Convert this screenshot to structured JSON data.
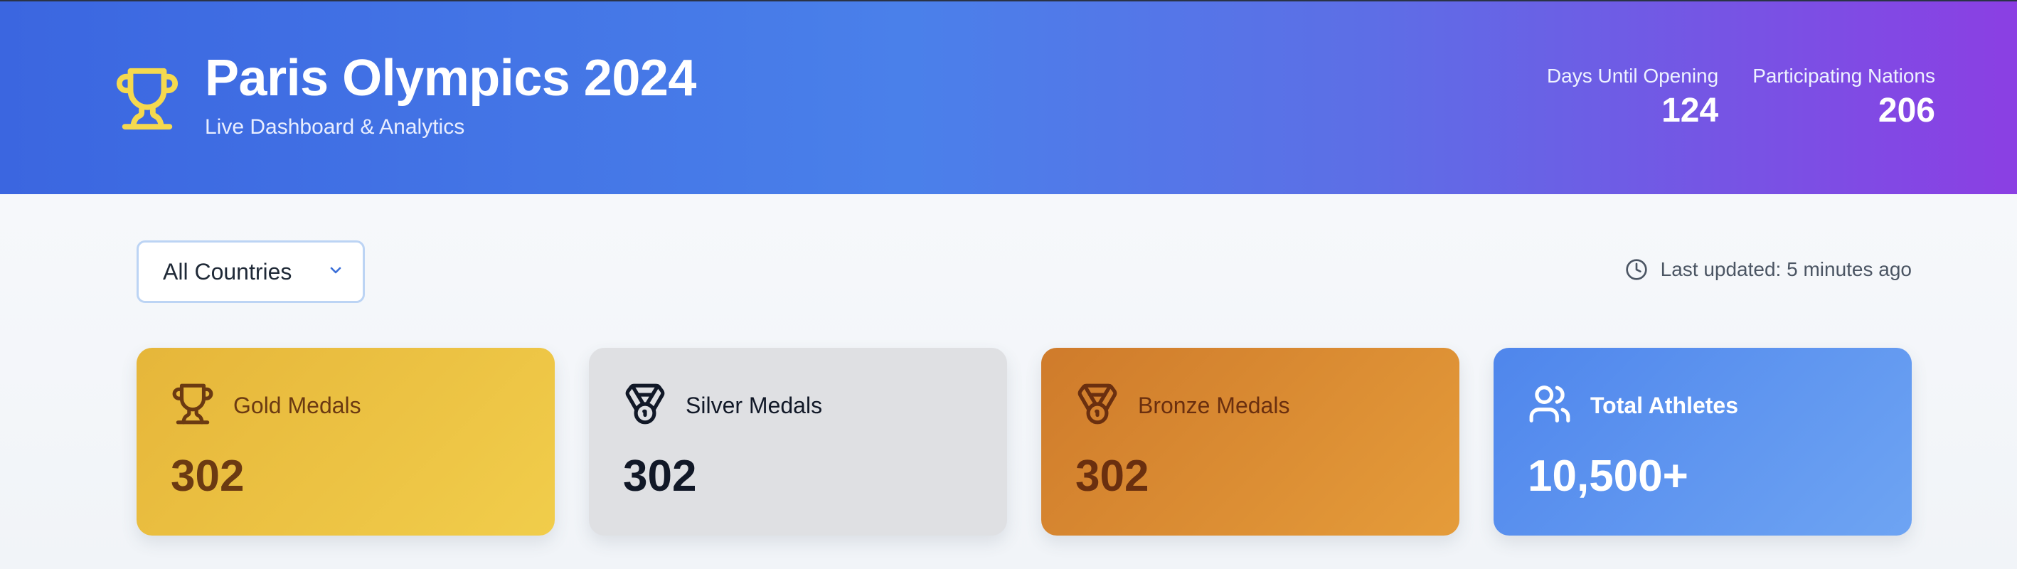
{
  "header": {
    "title": "Paris Olympics 2024",
    "subtitle": "Live Dashboard & Analytics",
    "stats": [
      {
        "label": "Days Until Opening",
        "value": "124"
      },
      {
        "label": "Participating Nations",
        "value": "206"
      }
    ],
    "icon": "trophy-icon",
    "icon_color": "#f5d94e"
  },
  "filters": {
    "country_select": {
      "value": "All Countries"
    }
  },
  "status": {
    "last_updated": "Last updated: 5 minutes ago"
  },
  "cards": [
    {
      "label": "Gold Medals",
      "value": "302",
      "icon": "trophy-icon",
      "color": "#e9bf43"
    },
    {
      "label": "Silver Medals",
      "value": "302",
      "icon": "medal-icon",
      "color": "#dfe0e3"
    },
    {
      "label": "Bronze Medals",
      "value": "302",
      "icon": "medal-icon",
      "color": "#dc8f35"
    },
    {
      "label": "Total Athletes",
      "value": "10,500+",
      "icon": "users-icon",
      "color": "#5b91ef"
    }
  ]
}
